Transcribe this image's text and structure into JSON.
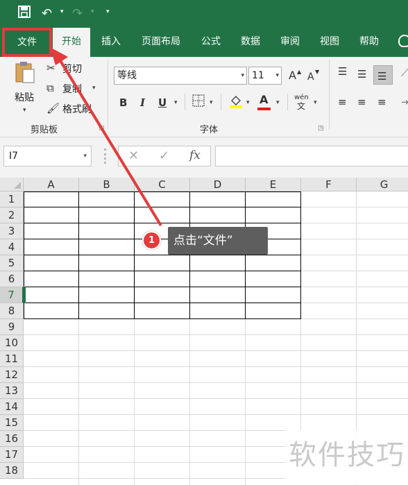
{
  "qat": {
    "save_icon": "save-icon",
    "undo_glyph": "↶",
    "redo_glyph": "↷",
    "customize_glyph": "▾"
  },
  "tabs": [
    {
      "label": "文件"
    },
    {
      "label": "开始"
    },
    {
      "label": "插入"
    },
    {
      "label": "页面布局"
    },
    {
      "label": "公式"
    },
    {
      "label": "数据"
    },
    {
      "label": "审阅"
    },
    {
      "label": "视图"
    },
    {
      "label": "帮助"
    }
  ],
  "ribbon": {
    "clipboard": {
      "paste_label": "粘贴",
      "cut_label": "剪切",
      "copy_label": "复制",
      "format_painter_label": "格式刷",
      "group_label": "剪贴板"
    },
    "font": {
      "font_name": "等线",
      "font_size": "11",
      "grow_label": "A",
      "shrink_label": "A",
      "bold_label": "B",
      "italic_label": "I",
      "underline_label": "U",
      "font_color_label": "A",
      "phonetic_label": "wén",
      "phonetic_sub": "文",
      "group_label": "字体"
    }
  },
  "formula_bar": {
    "name_box": "I7",
    "cancel_glyph": "✕",
    "enter_glyph": "✓",
    "fx_label": "fx",
    "formula": ""
  },
  "grid": {
    "columns": [
      "A",
      "B",
      "C",
      "D",
      "E",
      "F",
      "G"
    ],
    "rows": [
      "1",
      "2",
      "3",
      "4",
      "5",
      "6",
      "7",
      "8",
      "9",
      "10",
      "11",
      "12",
      "13",
      "14",
      "15",
      "16",
      "17",
      "18"
    ],
    "selected_row": "7"
  },
  "annotation": {
    "step_number": "1",
    "callout_text": "点击“文件”"
  },
  "watermark": "软件技巧",
  "colors": {
    "brand_green": "#217346",
    "highlight_red": "#e23c3c",
    "ribbon_bg": "#f3f3f3"
  }
}
